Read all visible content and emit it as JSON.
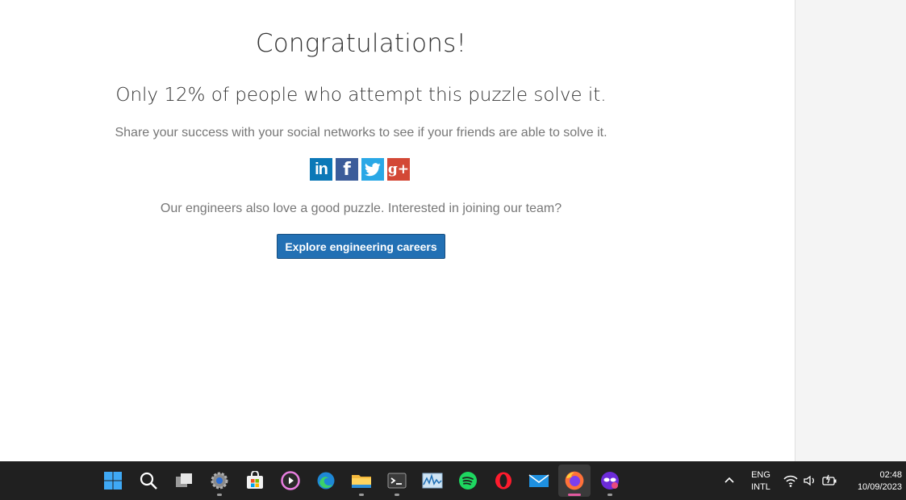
{
  "content": {
    "title": "Congratulations!",
    "stat": "Only 12% of people who attempt this puzzle solve it.",
    "share_text": "Share your success with your social networks to see if your friends are able to solve it.",
    "social": {
      "linkedin": "in",
      "facebook": "f",
      "google_plus": "g+"
    },
    "team_text": "Our engineers also love a good puzzle. Interested in joining our team?",
    "cta_label": "Explore engineering careers"
  },
  "taskbar": {
    "apps": [
      "start-icon",
      "search-icon",
      "task-view-icon",
      "settings-icon",
      "store-icon",
      "media-player-icon",
      "edge-icon",
      "file-explorer-icon",
      "terminal-icon",
      "resource-monitor-icon",
      "spotify-icon",
      "opera-icon",
      "mail-icon",
      "firefox-icon",
      "privacy-app-icon"
    ],
    "lang_line1": "ENG",
    "lang_line2": "INTL",
    "time": "02:48",
    "date": "10/09/2023"
  },
  "colors": {
    "cta": "#2270b4",
    "linkedin": "#0b78b7",
    "facebook": "#3b5c9a",
    "twitter": "#2aa8e6",
    "google_plus": "#d34836",
    "taskbar": "#202020",
    "active_indicator": "#e25a9f"
  }
}
